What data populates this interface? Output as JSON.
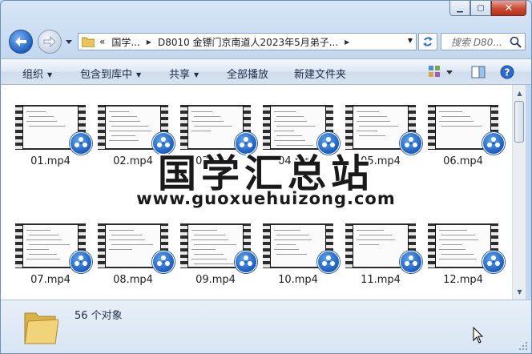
{
  "window": {
    "caption": {
      "minimize_icon": "minimize-icon",
      "maximize_icon": "maximize-icon",
      "close_icon": "close-icon"
    }
  },
  "address_bar": {
    "overflow": "«",
    "crumbs": [
      "国学...",
      "D8010 金镖门京南道人2023年5月弟子..."
    ],
    "refresh_icon": "refresh-icon"
  },
  "search": {
    "placeholder": "搜索 D80..."
  },
  "toolbar": {
    "organize": "组织",
    "include_in_library": "包含到库中",
    "share": "共享",
    "play_all": "全部播放",
    "new_folder": "新建文件夹"
  },
  "files": [
    {
      "name": "01.mp4"
    },
    {
      "name": "02.mp4"
    },
    {
      "name": "03.mp4"
    },
    {
      "name": "04.mp4"
    },
    {
      "name": "05.mp4"
    },
    {
      "name": "06.mp4"
    },
    {
      "name": "07.mp4"
    },
    {
      "name": "08.mp4"
    },
    {
      "name": "09.mp4"
    },
    {
      "name": "10.mp4"
    },
    {
      "name": "11.mp4"
    },
    {
      "name": "12.mp4"
    }
  ],
  "watermark": {
    "title": "国学汇总站",
    "url": "www.guoxuehuizong.com"
  },
  "status": {
    "count": "56 个对象"
  },
  "colors": {
    "accent": "#1d5cbd",
    "window_frame": "#c3d8ef",
    "close_button": "#c74a35"
  }
}
